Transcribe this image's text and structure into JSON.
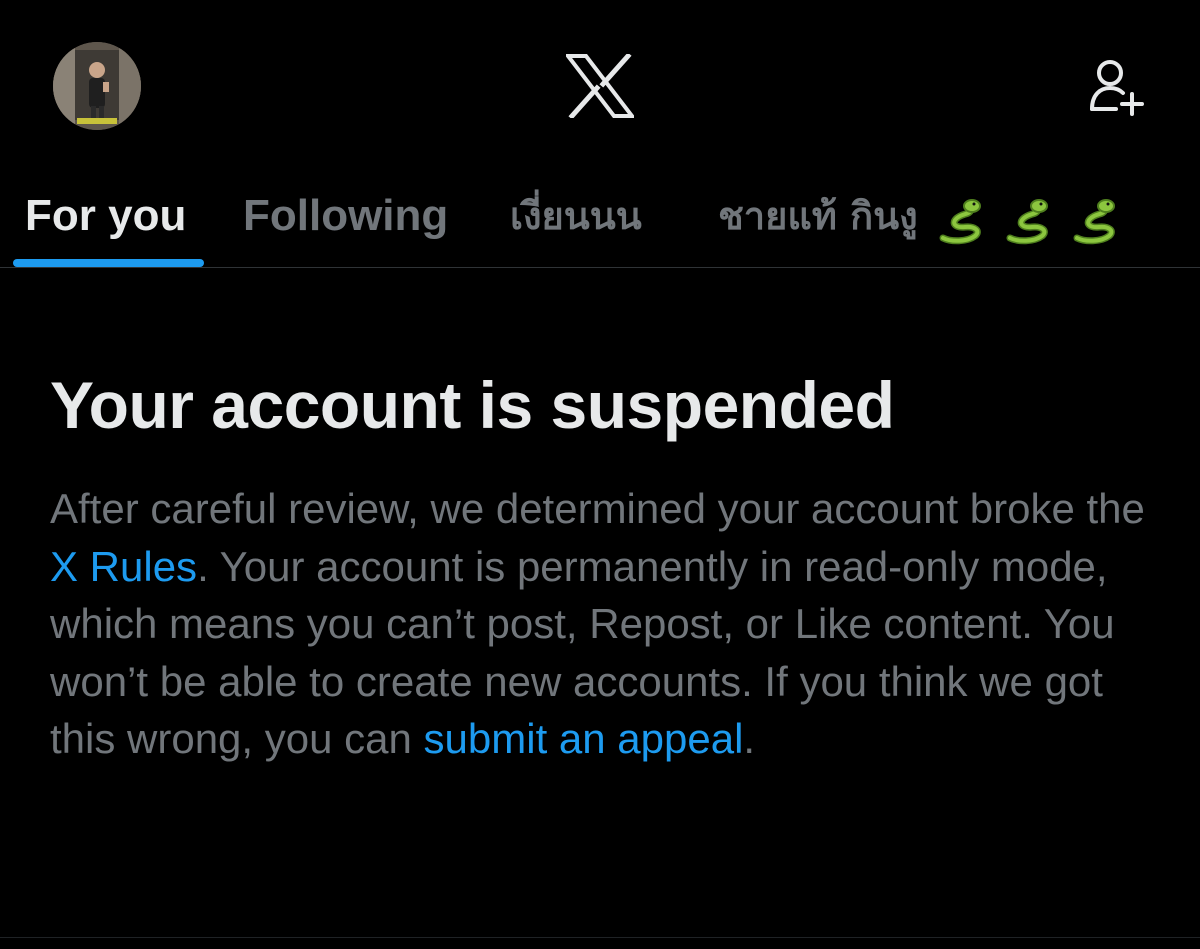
{
  "header": {
    "avatar_alt": "profile photo",
    "logo_icon": "x-logo-icon",
    "add_user_icon": "person-add-icon"
  },
  "tabs": [
    {
      "label": "For you",
      "active": true
    },
    {
      "label": "Following",
      "active": false
    },
    {
      "label": "เงี่ยนนน",
      "active": false
    },
    {
      "label": "ชายแท้ กินงู",
      "active": false,
      "trailing_icons": [
        "snake-emoji",
        "snake-emoji",
        "snake-emoji"
      ]
    }
  ],
  "notice": {
    "title": "Your account is suspended",
    "body_part1": "After careful review, we determined your account broke the ",
    "rules_link": "X Rules",
    "body_part2": ". Your account is permanently in read-only mode, which means you can’t post, Repost, or Like content. You won’t be able to create new accounts. If you think we got this wrong, you can ",
    "appeal_link": "submit an appeal",
    "body_part3": "."
  },
  "colors": {
    "background": "#000000",
    "primary_text": "#e7e9ea",
    "secondary_text": "#71767b",
    "accent": "#1d9bf0",
    "divider": "#2f3336"
  }
}
